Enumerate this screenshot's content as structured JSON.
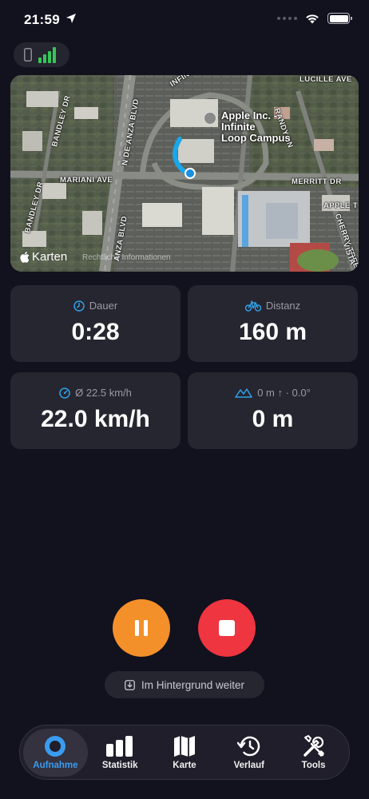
{
  "status_bar": {
    "time": "21:59"
  },
  "map": {
    "brand": "Karten",
    "legal": "Rechtliche Informationen",
    "poi_label": "Apple Inc. -\nInfinite\nLoop Campus",
    "streets": [
      "INFINITE LOOP",
      "LUCILLE AVE",
      "BANDLEY DR",
      "N DE ANZA BLVD",
      "MARIANI AVE",
      "RANDY LN",
      "MERRITT DR",
      "BANDLEY DR",
      "ANZA BLVD",
      "APPLE T",
      "CHERRY TREE",
      "VISTA"
    ]
  },
  "stats": [
    {
      "icon": "clock-icon",
      "label": "Dauer",
      "value": "0:28"
    },
    {
      "icon": "bicycle-icon",
      "label": "Distanz",
      "value": "160 m"
    },
    {
      "icon": "speedometer-icon",
      "label": "Ø 22.5 km/h",
      "value": "22.0 km/h"
    },
    {
      "icon": "mountains-icon",
      "label": "0 m ↑ · 0.0°",
      "value": "0 m"
    }
  ],
  "controls": {
    "background_label": "Im Hintergrund weiter"
  },
  "tabs": [
    {
      "label": "Aufnahme",
      "active": true
    },
    {
      "label": "Statistik",
      "active": false
    },
    {
      "label": "Karte",
      "active": false
    },
    {
      "label": "Verlauf",
      "active": false
    },
    {
      "label": "Tools",
      "active": false
    }
  ],
  "colors": {
    "accent": "#3a9cf0",
    "pause": "#f4902a",
    "stop": "#ef3540",
    "track": "#1aa6e8",
    "background": "#12111e",
    "card": "#262630"
  }
}
